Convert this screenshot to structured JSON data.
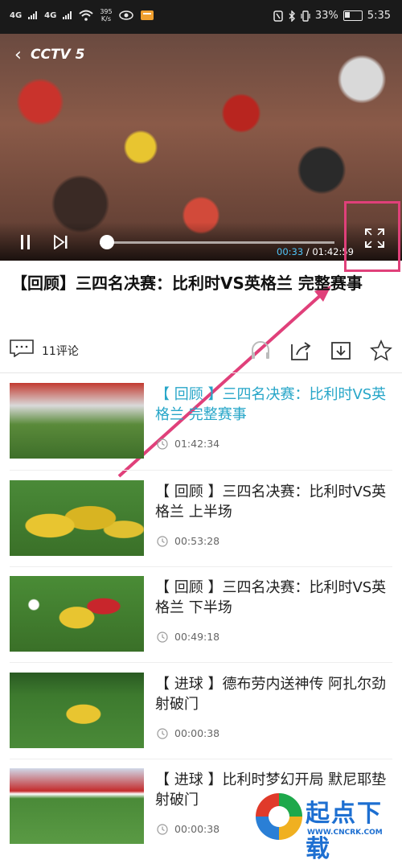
{
  "status_bar": {
    "signal1": "4G",
    "signal2": "4G",
    "speed_value": "395",
    "speed_unit": "K/s",
    "battery": "33%",
    "time": "5:35"
  },
  "player": {
    "channel_logo": "CCTV 5",
    "time_current": "00:33",
    "time_total": "01:42:59",
    "progress": 0.005,
    "highlight_color": "#e0407a"
  },
  "video": {
    "title": "【回顾】三四名决赛：比利时VS英格兰 完整赛事"
  },
  "actions": {
    "comment_count": "11评论"
  },
  "list": [
    {
      "title": "【 回顾 】三四名决赛：比利时VS英格兰 完整赛事",
      "duration": "01:42:34",
      "active": true
    },
    {
      "title": "【 回顾 】三四名决赛：比利时VS英格兰 上半场",
      "duration": "00:53:28",
      "active": false
    },
    {
      "title": "【 回顾 】三四名决赛：比利时VS英格兰 下半场",
      "duration": "00:49:18",
      "active": false
    },
    {
      "title": "【 进球 】德布劳内送神传 阿扎尔劲射破门",
      "duration": "00:00:38",
      "active": false
    },
    {
      "title": "【 进球 】比利时梦幻开局 默尼耶垫射破门",
      "duration": "00:00:38",
      "active": false
    }
  ],
  "watermark": {
    "text": "起点下载",
    "url": "WWW.CNCRK.COM"
  },
  "colors": {
    "accent_active_title": "#27a6c8",
    "current_time": "#4fc3f7",
    "annotation": "#e0407a"
  }
}
